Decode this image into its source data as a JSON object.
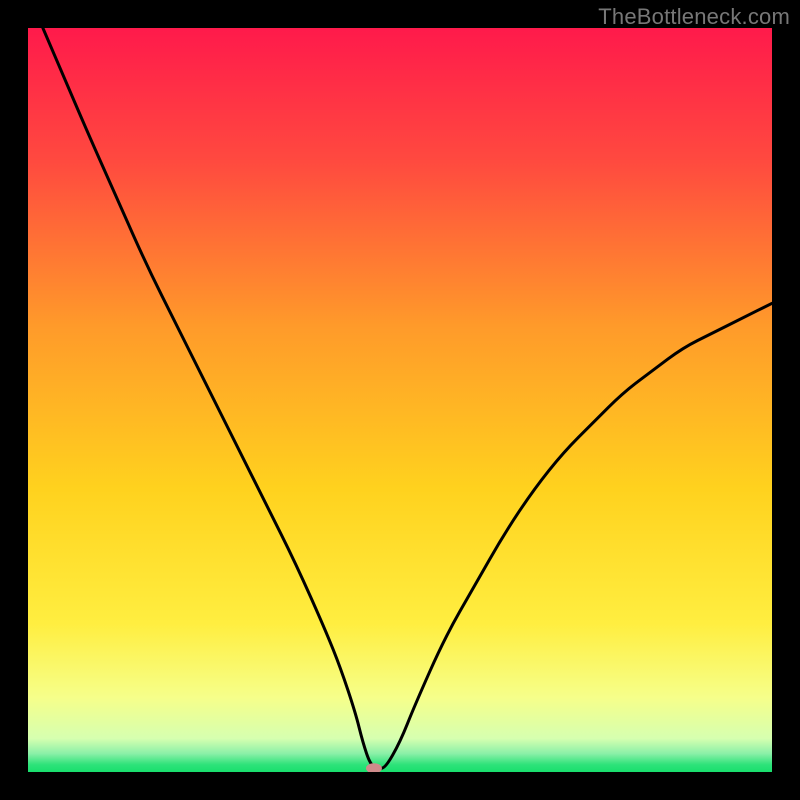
{
  "watermark": "TheBottleneck.com",
  "chart_data": {
    "type": "line",
    "title": "",
    "xlabel": "",
    "ylabel": "",
    "xlim": [
      0,
      100
    ],
    "ylim": [
      0,
      100
    ],
    "legend": false,
    "grid": false,
    "description": "Bottleneck curve: function starts at 100% on the left edge, descends steeply to a near-zero minimum at x≈46, then rises more gradually toward ~63% at the right edge. Background is a vertical gradient red→orange→yellow→green over a thin green band at the bottom.",
    "series": [
      {
        "name": "bottleneck",
        "x": [
          2,
          5,
          8,
          12,
          16,
          20,
          24,
          28,
          32,
          36,
          40,
          42,
          44,
          45,
          46,
          47,
          48,
          50,
          52,
          56,
          60,
          64,
          68,
          72,
          76,
          80,
          84,
          88,
          92,
          96,
          100
        ],
        "values": [
          100,
          93,
          86,
          77,
          68,
          60,
          52,
          44,
          36,
          28,
          19,
          14,
          8,
          4,
          1,
          0.5,
          0.5,
          4,
          9,
          18,
          25,
          32,
          38,
          43,
          47,
          51,
          54,
          57,
          59,
          61,
          63
        ]
      }
    ],
    "marker": {
      "x": 46.5,
      "y": 0.5,
      "color": "#cf8b8b",
      "rx": 8,
      "ry": 5
    },
    "background_gradient": {
      "stops": [
        {
          "offset": 0.0,
          "color": "#ff1a4b"
        },
        {
          "offset": 0.18,
          "color": "#ff4a3f"
        },
        {
          "offset": 0.4,
          "color": "#ff9a2a"
        },
        {
          "offset": 0.62,
          "color": "#ffd21e"
        },
        {
          "offset": 0.8,
          "color": "#ffee40"
        },
        {
          "offset": 0.9,
          "color": "#f6ff8a"
        },
        {
          "offset": 0.955,
          "color": "#d6ffb0"
        },
        {
          "offset": 0.975,
          "color": "#8cf0a8"
        },
        {
          "offset": 0.99,
          "color": "#2ee37a"
        },
        {
          "offset": 1.0,
          "color": "#18df6d"
        }
      ]
    }
  }
}
